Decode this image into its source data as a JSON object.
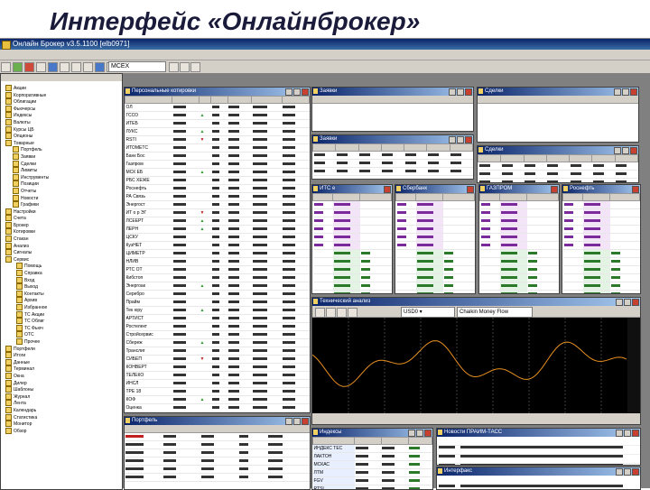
{
  "slide": {
    "title": "Интерфейс «Онлайнброкер»"
  },
  "window": {
    "title": "Онлайн Брокер v3.5.1100 [elb0971]"
  },
  "toolbar": {
    "ticker_select": "МСЕХ"
  },
  "panes": {
    "quotes": {
      "title": "Персональные котировки"
    },
    "bids": {
      "title": "Заявки"
    },
    "deals": {
      "title": "Сделки"
    },
    "orders": {
      "title": "Заявки"
    },
    "trades": {
      "title": "Сделки"
    },
    "glass1": {
      "title": "ИТС е"
    },
    "glass2": {
      "title": "Сбербанк"
    },
    "glass3": {
      "title": "ГАЗПРОМ"
    },
    "glass4": {
      "title": "Роснефть"
    },
    "chart": {
      "title": "Технический анализ",
      "symbol": "USD0 ▾",
      "indicator": "Chaikin Money Flow"
    },
    "indices": {
      "title": "Индексы"
    },
    "news": {
      "title": "Новости ПРАЙМ-ТАСС"
    },
    "portfolio": {
      "title": "Портфель"
    },
    "interfax": {
      "title": "Интерфакс"
    }
  },
  "quotes_rows": [
    "ОЛ",
    "ГССО",
    "ИТЕБ",
    "ЛУКС",
    "RSTI",
    "ИТОМЕТС",
    "Банк Бос",
    "Газпром",
    "МСК ЕБ",
    "РБС ХЕЖЕ",
    "Роснефть",
    "РА Связь",
    "Энергост",
    "ИТ о р ЭГ",
    "ЛСЕЕРТ",
    "ЛЕРН",
    "ЦСКУ",
    "КузНЕТ",
    "ЦИМЕТР",
    "НЛИВ",
    "РТС ОТ",
    "Кибстоп",
    "Энергоак",
    "Серебро",
    "Прайм",
    "Тек юру",
    "АРТИСТ",
    "Ростелект",
    "Стройсервис",
    "Сбереж",
    "Транслиг",
    "СИБЕП",
    "КОНВЕРТ",
    "ТЕЛЕКО",
    "ИНСЛ",
    "ТРЕ 18",
    "КОФ",
    "Оценка",
    "Кострон"
  ],
  "indices_rows": [
    "ИНДЕКС ТЕС",
    "ЛАКТОН",
    "МСКАС",
    "ЛТМ",
    "FGV",
    "RTSI",
    "ЛИК",
    "КБ ЕЗЕ"
  ],
  "tree_items": [
    "Акции",
    "Корпоративные",
    "Облигации",
    "Фьючерсы",
    "Индексы",
    "Валюты",
    "Курсы ЦБ",
    "Опционы",
    "Товарные",
    "Портфель",
    "Заявки",
    "Сделки",
    "Лимиты",
    "Инструменты",
    "Позиции",
    "Отчеты",
    "Новости",
    "Графики",
    "Настройки",
    "Счета",
    "Брокер",
    "Котировки",
    "Стакан",
    "Анализ",
    "Сигналы",
    "Сервис",
    "Помощь",
    "Справка",
    "Вход",
    "Выход",
    "Контакты",
    "Архив",
    "Избранное",
    "ТС Акции",
    "ТС Облиг",
    "ТС Фьюч",
    "ОТС",
    "Прочее",
    "Портфели",
    "Итоги",
    "Данные",
    "Терминал",
    "Окна",
    "Дилер",
    "Шаблоны",
    "Журнал",
    "Лента",
    "Календарь",
    "Статистика",
    "Монитор",
    "Обзор"
  ],
  "quote_row_count": 39,
  "glass_row_count": 12,
  "indices_row_count": 8,
  "news_row_count": 9
}
